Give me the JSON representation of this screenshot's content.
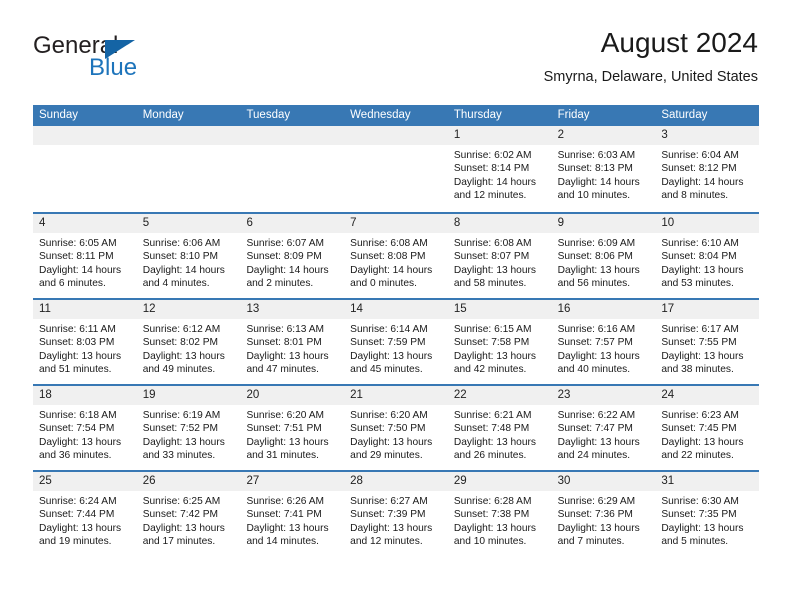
{
  "brand": {
    "name_part1": "General",
    "name_part2": "Blue",
    "triangle_color": "#1464a5",
    "blue_color": "#1d74bb"
  },
  "header": {
    "title": "August 2024",
    "subtitle": "Smyrna, Delaware, United States"
  },
  "theme": {
    "header_row_bg": "#3878b4",
    "day_number_strip_bg": "#f0f0f0",
    "week_divider": "#3878b4",
    "text": "#1a1a1a"
  },
  "calendar": {
    "day_names": [
      "Sunday",
      "Monday",
      "Tuesday",
      "Wednesday",
      "Thursday",
      "Friday",
      "Saturday"
    ],
    "weeks": [
      [
        {
          "day": "",
          "empty": true,
          "sunrise": "",
          "sunset": "",
          "daylight_line1": "",
          "daylight_line2": ""
        },
        {
          "day": "",
          "empty": true,
          "sunrise": "",
          "sunset": "",
          "daylight_line1": "",
          "daylight_line2": ""
        },
        {
          "day": "",
          "empty": true,
          "sunrise": "",
          "sunset": "",
          "daylight_line1": "",
          "daylight_line2": ""
        },
        {
          "day": "",
          "empty": true,
          "sunrise": "",
          "sunset": "",
          "daylight_line1": "",
          "daylight_line2": ""
        },
        {
          "day": "1",
          "sunrise": "Sunrise: 6:02 AM",
          "sunset": "Sunset: 8:14 PM",
          "daylight_line1": "Daylight: 14 hours",
          "daylight_line2": "and 12 minutes."
        },
        {
          "day": "2",
          "sunrise": "Sunrise: 6:03 AM",
          "sunset": "Sunset: 8:13 PM",
          "daylight_line1": "Daylight: 14 hours",
          "daylight_line2": "and 10 minutes."
        },
        {
          "day": "3",
          "sunrise": "Sunrise: 6:04 AM",
          "sunset": "Sunset: 8:12 PM",
          "daylight_line1": "Daylight: 14 hours",
          "daylight_line2": "and 8 minutes."
        }
      ],
      [
        {
          "day": "4",
          "sunrise": "Sunrise: 6:05 AM",
          "sunset": "Sunset: 8:11 PM",
          "daylight_line1": "Daylight: 14 hours",
          "daylight_line2": "and 6 minutes."
        },
        {
          "day": "5",
          "sunrise": "Sunrise: 6:06 AM",
          "sunset": "Sunset: 8:10 PM",
          "daylight_line1": "Daylight: 14 hours",
          "daylight_line2": "and 4 minutes."
        },
        {
          "day": "6",
          "sunrise": "Sunrise: 6:07 AM",
          "sunset": "Sunset: 8:09 PM",
          "daylight_line1": "Daylight: 14 hours",
          "daylight_line2": "and 2 minutes."
        },
        {
          "day": "7",
          "sunrise": "Sunrise: 6:08 AM",
          "sunset": "Sunset: 8:08 PM",
          "daylight_line1": "Daylight: 14 hours",
          "daylight_line2": "and 0 minutes."
        },
        {
          "day": "8",
          "sunrise": "Sunrise: 6:08 AM",
          "sunset": "Sunset: 8:07 PM",
          "daylight_line1": "Daylight: 13 hours",
          "daylight_line2": "and 58 minutes."
        },
        {
          "day": "9",
          "sunrise": "Sunrise: 6:09 AM",
          "sunset": "Sunset: 8:06 PM",
          "daylight_line1": "Daylight: 13 hours",
          "daylight_line2": "and 56 minutes."
        },
        {
          "day": "10",
          "sunrise": "Sunrise: 6:10 AM",
          "sunset": "Sunset: 8:04 PM",
          "daylight_line1": "Daylight: 13 hours",
          "daylight_line2": "and 53 minutes."
        }
      ],
      [
        {
          "day": "11",
          "sunrise": "Sunrise: 6:11 AM",
          "sunset": "Sunset: 8:03 PM",
          "daylight_line1": "Daylight: 13 hours",
          "daylight_line2": "and 51 minutes."
        },
        {
          "day": "12",
          "sunrise": "Sunrise: 6:12 AM",
          "sunset": "Sunset: 8:02 PM",
          "daylight_line1": "Daylight: 13 hours",
          "daylight_line2": "and 49 minutes."
        },
        {
          "day": "13",
          "sunrise": "Sunrise: 6:13 AM",
          "sunset": "Sunset: 8:01 PM",
          "daylight_line1": "Daylight: 13 hours",
          "daylight_line2": "and 47 minutes."
        },
        {
          "day": "14",
          "sunrise": "Sunrise: 6:14 AM",
          "sunset": "Sunset: 7:59 PM",
          "daylight_line1": "Daylight: 13 hours",
          "daylight_line2": "and 45 minutes."
        },
        {
          "day": "15",
          "sunrise": "Sunrise: 6:15 AM",
          "sunset": "Sunset: 7:58 PM",
          "daylight_line1": "Daylight: 13 hours",
          "daylight_line2": "and 42 minutes."
        },
        {
          "day": "16",
          "sunrise": "Sunrise: 6:16 AM",
          "sunset": "Sunset: 7:57 PM",
          "daylight_line1": "Daylight: 13 hours",
          "daylight_line2": "and 40 minutes."
        },
        {
          "day": "17",
          "sunrise": "Sunrise: 6:17 AM",
          "sunset": "Sunset: 7:55 PM",
          "daylight_line1": "Daylight: 13 hours",
          "daylight_line2": "and 38 minutes."
        }
      ],
      [
        {
          "day": "18",
          "sunrise": "Sunrise: 6:18 AM",
          "sunset": "Sunset: 7:54 PM",
          "daylight_line1": "Daylight: 13 hours",
          "daylight_line2": "and 36 minutes."
        },
        {
          "day": "19",
          "sunrise": "Sunrise: 6:19 AM",
          "sunset": "Sunset: 7:52 PM",
          "daylight_line1": "Daylight: 13 hours",
          "daylight_line2": "and 33 minutes."
        },
        {
          "day": "20",
          "sunrise": "Sunrise: 6:20 AM",
          "sunset": "Sunset: 7:51 PM",
          "daylight_line1": "Daylight: 13 hours",
          "daylight_line2": "and 31 minutes."
        },
        {
          "day": "21",
          "sunrise": "Sunrise: 6:20 AM",
          "sunset": "Sunset: 7:50 PM",
          "daylight_line1": "Daylight: 13 hours",
          "daylight_line2": "and 29 minutes."
        },
        {
          "day": "22",
          "sunrise": "Sunrise: 6:21 AM",
          "sunset": "Sunset: 7:48 PM",
          "daylight_line1": "Daylight: 13 hours",
          "daylight_line2": "and 26 minutes."
        },
        {
          "day": "23",
          "sunrise": "Sunrise: 6:22 AM",
          "sunset": "Sunset: 7:47 PM",
          "daylight_line1": "Daylight: 13 hours",
          "daylight_line2": "and 24 minutes."
        },
        {
          "day": "24",
          "sunrise": "Sunrise: 6:23 AM",
          "sunset": "Sunset: 7:45 PM",
          "daylight_line1": "Daylight: 13 hours",
          "daylight_line2": "and 22 minutes."
        }
      ],
      [
        {
          "day": "25",
          "sunrise": "Sunrise: 6:24 AM",
          "sunset": "Sunset: 7:44 PM",
          "daylight_line1": "Daylight: 13 hours",
          "daylight_line2": "and 19 minutes."
        },
        {
          "day": "26",
          "sunrise": "Sunrise: 6:25 AM",
          "sunset": "Sunset: 7:42 PM",
          "daylight_line1": "Daylight: 13 hours",
          "daylight_line2": "and 17 minutes."
        },
        {
          "day": "27",
          "sunrise": "Sunrise: 6:26 AM",
          "sunset": "Sunset: 7:41 PM",
          "daylight_line1": "Daylight: 13 hours",
          "daylight_line2": "and 14 minutes."
        },
        {
          "day": "28",
          "sunrise": "Sunrise: 6:27 AM",
          "sunset": "Sunset: 7:39 PM",
          "daylight_line1": "Daylight: 13 hours",
          "daylight_line2": "and 12 minutes."
        },
        {
          "day": "29",
          "sunrise": "Sunrise: 6:28 AM",
          "sunset": "Sunset: 7:38 PM",
          "daylight_line1": "Daylight: 13 hours",
          "daylight_line2": "and 10 minutes."
        },
        {
          "day": "30",
          "sunrise": "Sunrise: 6:29 AM",
          "sunset": "Sunset: 7:36 PM",
          "daylight_line1": "Daylight: 13 hours",
          "daylight_line2": "and 7 minutes."
        },
        {
          "day": "31",
          "sunrise": "Sunrise: 6:30 AM",
          "sunset": "Sunset: 7:35 PM",
          "daylight_line1": "Daylight: 13 hours",
          "daylight_line2": "and 5 minutes."
        }
      ]
    ]
  }
}
